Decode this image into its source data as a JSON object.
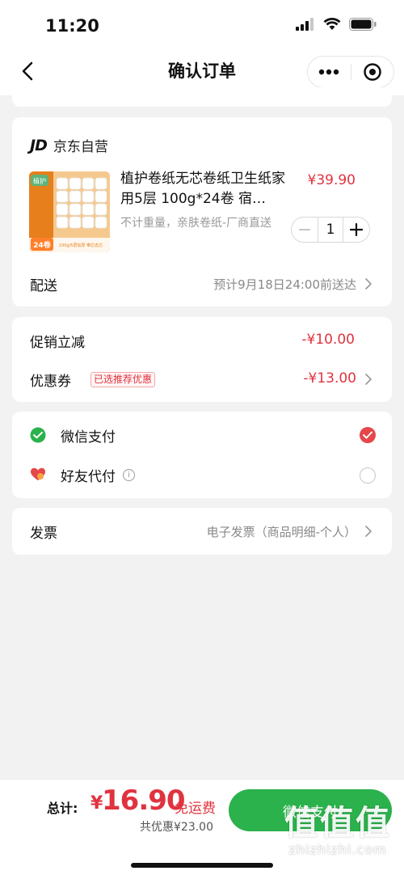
{
  "status_bar": {
    "time": "11:20"
  },
  "nav": {
    "title": "确认订单"
  },
  "shop": {
    "logo": "JD",
    "name": "京东自营"
  },
  "product": {
    "title": "植护卷纸无芯卷纸卫生纸家用5层 100g*24卷 宿…",
    "spec": "不计重量，亲肤卷纸-厂商直送",
    "price": "¥39.90",
    "quantity": "1",
    "image_text_brand": "植护",
    "image_text_count": "24卷",
    "image_text_tag": "100g/5层加厚 带芯去芯"
  },
  "delivery": {
    "label": "配送",
    "value": "预计9月18日24:00前送达"
  },
  "promo": {
    "discount_label": "促销立减",
    "discount_value": "-¥10.00",
    "coupon_label": "优惠券",
    "coupon_tag": "已选推荐优惠",
    "coupon_value": "-¥13.00"
  },
  "payment": {
    "wechat_label": "微信支付",
    "friend_label": "好友代付",
    "info_glyph": "i"
  },
  "invoice": {
    "label": "发票",
    "value": "电子发票（商品明细-个人）"
  },
  "footer": {
    "total_label": "总计:",
    "currency": "¥",
    "total_amount": "16.90",
    "free_shipping": "免运费",
    "saved": "共优惠¥23.00",
    "pay_button": "微信支付"
  },
  "watermark": {
    "logo": "值值值",
    "text": "zhizhizhi.com"
  },
  "colors": {
    "accent_red": "#e0333f",
    "wechat_green": "#2bb24c"
  }
}
